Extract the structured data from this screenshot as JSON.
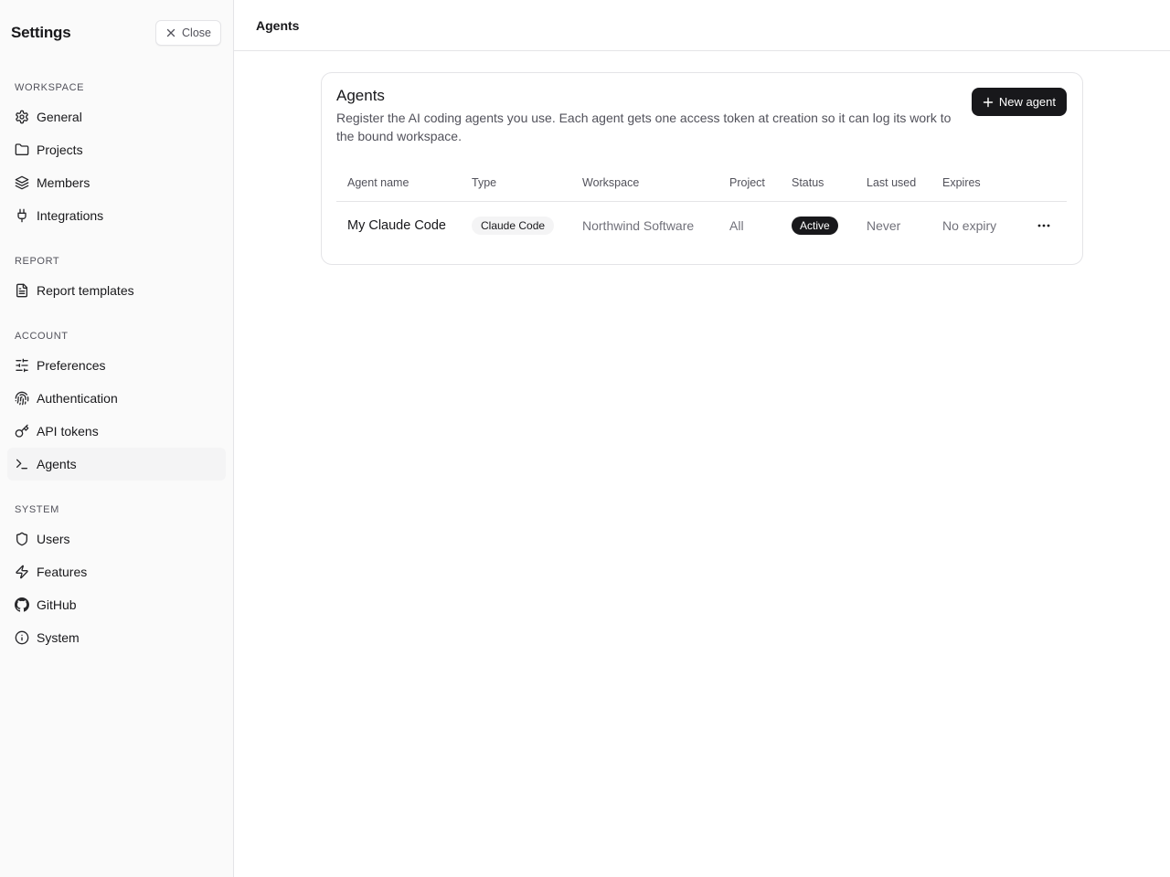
{
  "sidebar": {
    "title": "Settings",
    "close_label": "Close",
    "sections": [
      {
        "label": "WORKSPACE",
        "items": [
          {
            "label": "General",
            "icon": "gear-icon"
          },
          {
            "label": "Projects",
            "icon": "folder-icon"
          },
          {
            "label": "Members",
            "icon": "layers-icon"
          },
          {
            "label": "Integrations",
            "icon": "plug-icon"
          }
        ]
      },
      {
        "label": "REPORT",
        "items": [
          {
            "label": "Report templates",
            "icon": "document-icon"
          }
        ]
      },
      {
        "label": "ACCOUNT",
        "items": [
          {
            "label": "Preferences",
            "icon": "sliders-icon"
          },
          {
            "label": "Authentication",
            "icon": "fingerprint-icon"
          },
          {
            "label": "API tokens",
            "icon": "key-icon"
          },
          {
            "label": "Agents",
            "icon": "terminal-icon",
            "active": true
          }
        ]
      },
      {
        "label": "SYSTEM",
        "items": [
          {
            "label": "Users",
            "icon": "shield-icon"
          },
          {
            "label": "Features",
            "icon": "zap-icon"
          },
          {
            "label": "GitHub",
            "icon": "github-icon"
          },
          {
            "label": "System",
            "icon": "info-icon"
          }
        ]
      }
    ]
  },
  "header": {
    "title": "Agents"
  },
  "card": {
    "title": "Agents",
    "description": "Register the AI coding agents you use. Each agent gets one access token at creation so it can log its work to the bound workspace.",
    "new_button_label": "New agent",
    "table": {
      "columns": [
        "Agent name",
        "Type",
        "Workspace",
        "Project",
        "Status",
        "Last used",
        "Expires"
      ],
      "rows": [
        {
          "agent_name": "My Claude Code",
          "type": "Claude Code",
          "workspace": "Northwind Software",
          "project": "All",
          "status": "Active",
          "last_used": "Never",
          "expires": "No expiry"
        }
      ]
    }
  },
  "colors": {
    "accent": "#18181b",
    "sidebar_bg": "#fafafa",
    "border": "#e4e4e7",
    "muted_text": "#71717a"
  }
}
